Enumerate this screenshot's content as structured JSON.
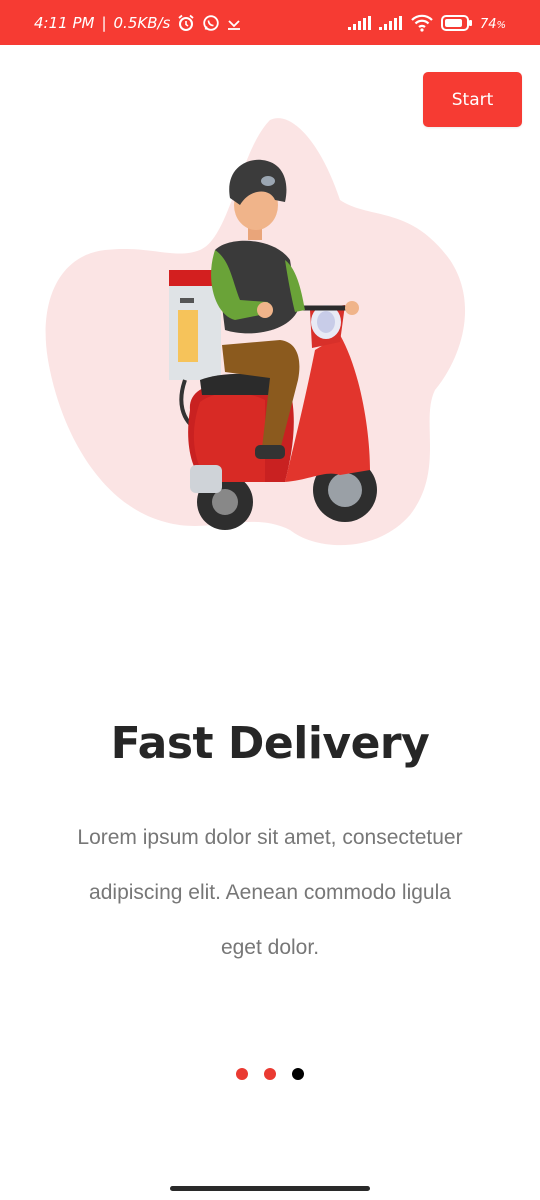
{
  "status_bar": {
    "time": "4:11 PM",
    "separator": "|",
    "network_speed": "0.5KB/s",
    "battery_level": "74",
    "icons": [
      "alarm-icon",
      "whatsapp-icon",
      "download-icon",
      "signal-icon",
      "signal-icon",
      "wifi-icon",
      "battery-icon"
    ]
  },
  "start_button": {
    "label": "Start"
  },
  "slide": {
    "illustration": "delivery-scooter-rider",
    "title": "Fast Delivery",
    "description": "Lorem ipsum dolor sit amet, consectetuer adipiscing elit. Aenean commodo ligula eget dolor."
  },
  "pagination": {
    "count": 3,
    "active_index": 2
  },
  "colors": {
    "accent": "#f63b33",
    "dot_inactive": "#ea3a32",
    "dot_active": "#000000",
    "blob": "#fbe4e4",
    "title": "#262626",
    "description": "#777777"
  }
}
